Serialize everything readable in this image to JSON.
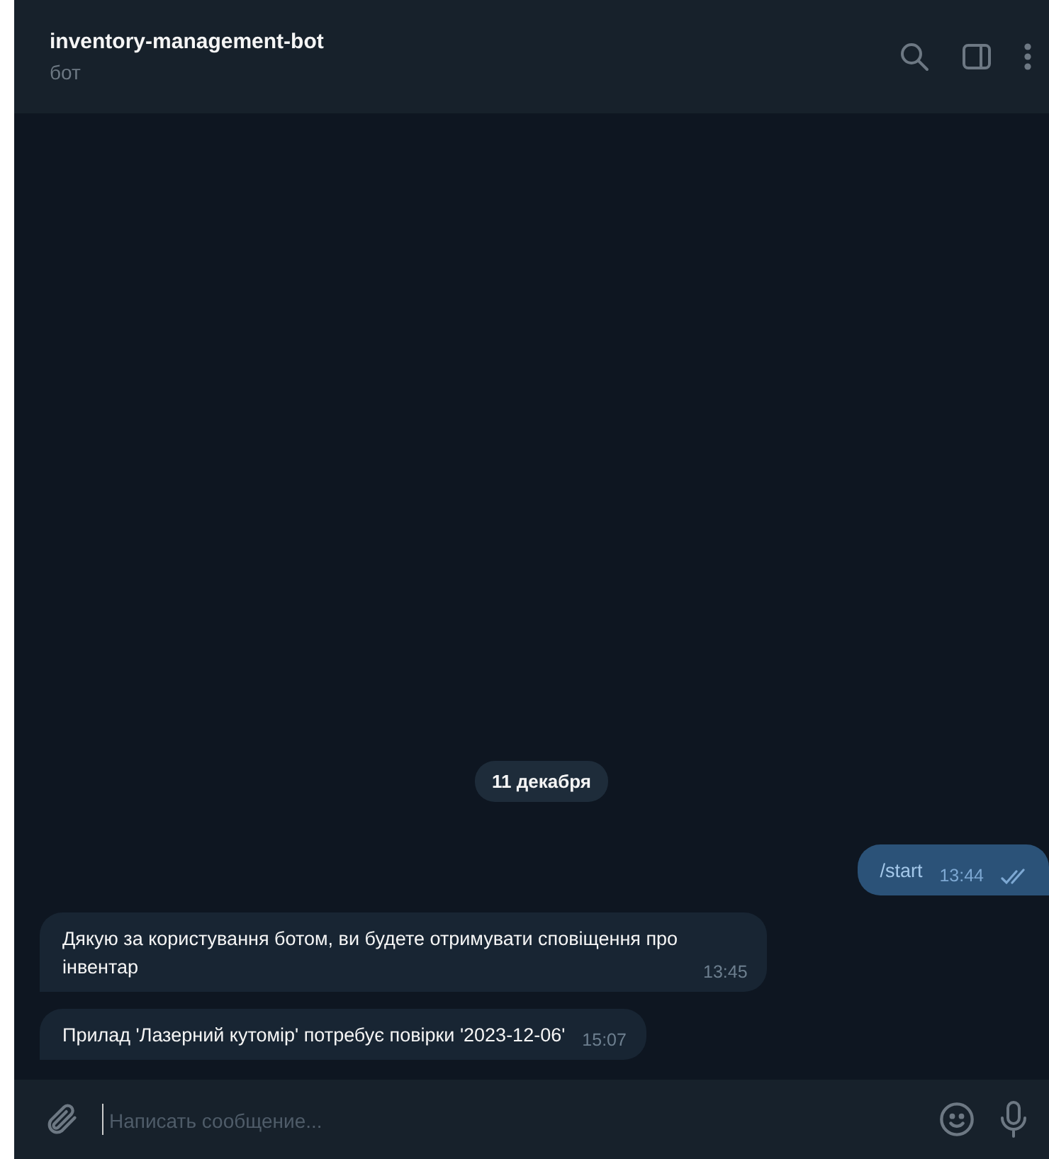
{
  "header": {
    "title": "inventory-management-bot",
    "subtitle": "бот"
  },
  "date_label": "11 декабря",
  "messages": [
    {
      "outgoing": true,
      "text": "/start",
      "time": "13:44",
      "read": true
    },
    {
      "outgoing": false,
      "text": "Дякую за користування ботом, ви будете отримувати сповіщення про інвентар",
      "time": "13:45"
    },
    {
      "outgoing": false,
      "text": "Прилад 'Лазерний кутомір' потребує повірки '2023-12-06'",
      "time": "15:07"
    }
  ],
  "composer": {
    "placeholder": "Написать сообщение..."
  }
}
